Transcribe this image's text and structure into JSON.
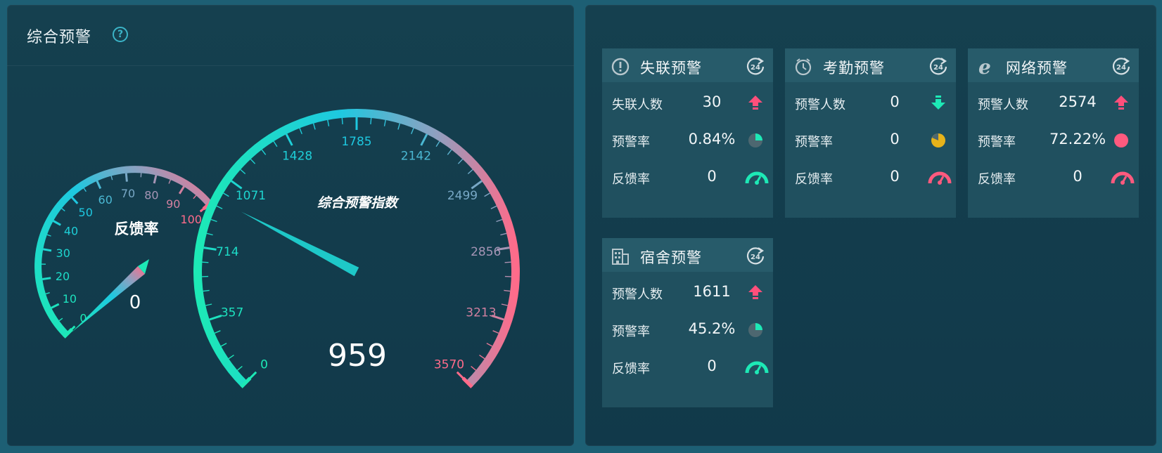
{
  "left_panel": {
    "title": "综合预警",
    "help_icon": "question-circle-icon"
  },
  "gauges": {
    "feedback": {
      "label": "反馈率",
      "value": 0,
      "value_text": "0",
      "min": 0,
      "max": 100,
      "ticks": [
        "0",
        "10",
        "20",
        "30",
        "40",
        "50",
        "60",
        "70",
        "80",
        "90",
        "100"
      ]
    },
    "composite": {
      "label": "综合预警指数",
      "value": 959,
      "value_text": "959",
      "min": 0,
      "max": 3570,
      "ticks": [
        "0",
        "357",
        "714",
        "1071",
        "1428",
        "1785",
        "2142",
        "2499",
        "2856",
        "3213",
        "3570"
      ]
    },
    "colors": {
      "start": "#1de9b6",
      "mid": "#1ec8e0",
      "end": "#ff6b8a"
    }
  },
  "cards": [
    {
      "title": "失联预警",
      "icon": "alert-circle-icon",
      "refresh_icon": "24h-refresh-icon",
      "rows": [
        {
          "label": "失联人数",
          "value": "30",
          "icon": "arrow-up-icon"
        },
        {
          "label": "预警率",
          "value": "0.84%",
          "icon": "pie-small-icon"
        },
        {
          "label": "反馈率",
          "value": "0",
          "icon": "speedometer-green-icon"
        }
      ]
    },
    {
      "title": "考勤预警",
      "icon": "clock-icon",
      "refresh_icon": "24h-refresh-icon",
      "rows": [
        {
          "label": "预警人数",
          "value": "0",
          "icon": "arrow-down-icon"
        },
        {
          "label": "预警率",
          "value": "0",
          "icon": "pie-yellow-icon"
        },
        {
          "label": "反馈率",
          "value": "0",
          "icon": "speedometer-red-icon"
        }
      ]
    },
    {
      "title": "网络预警",
      "icon": "browser-e-icon",
      "refresh_icon": "24h-refresh-icon",
      "rows": [
        {
          "label": "预警人数",
          "value": "2574",
          "icon": "arrow-up-icon"
        },
        {
          "label": "预警率",
          "value": "72.22%",
          "icon": "pie-full-red-icon"
        },
        {
          "label": "反馈率",
          "value": "0",
          "icon": "speedometer-red-icon"
        }
      ]
    },
    {
      "title": "宿舍预警",
      "icon": "building-icon",
      "refresh_icon": "24h-refresh-icon",
      "rows": [
        {
          "label": "预警人数",
          "value": "1611",
          "icon": "arrow-up-icon"
        },
        {
          "label": "预警率",
          "value": "45.2%",
          "icon": "pie-small-icon"
        },
        {
          "label": "反馈率",
          "value": "0",
          "icon": "speedometer-green-icon"
        }
      ]
    }
  ]
}
